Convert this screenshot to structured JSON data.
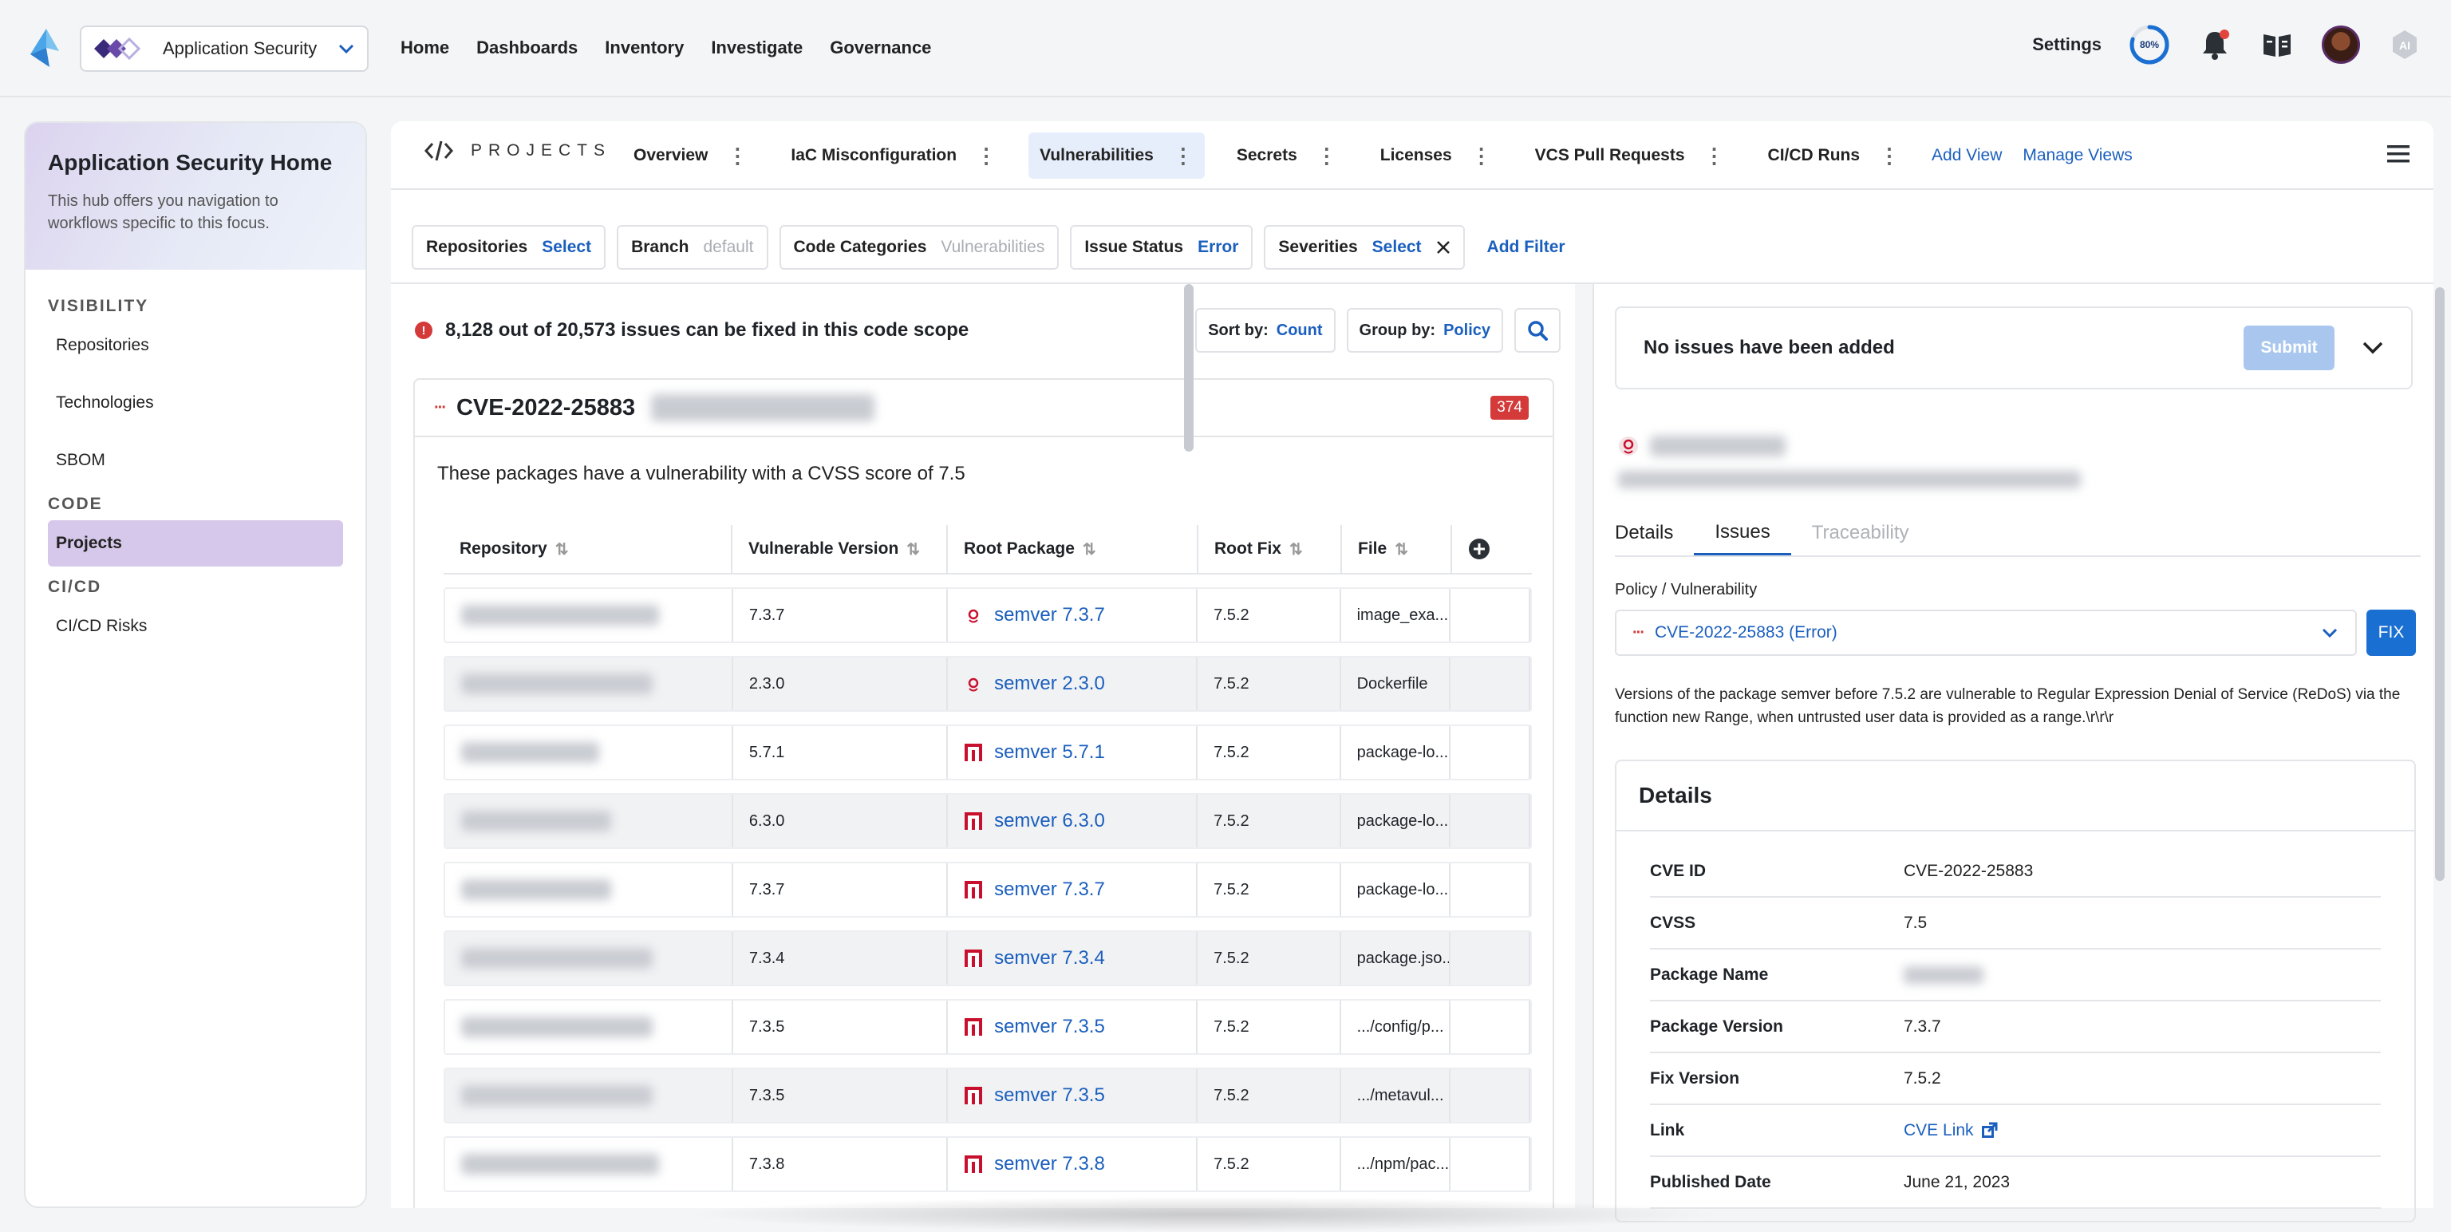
{
  "topnav": {
    "workspace": "Application Security",
    "items": [
      "Home",
      "Dashboards",
      "Inventory",
      "Investigate",
      "Governance"
    ],
    "active_item": "Home",
    "settings_label": "Settings",
    "progress_text": "80%",
    "progress_value": 0.8
  },
  "sidebar": {
    "title": "Application Security Home",
    "description": "This hub offers you navigation to workflows specific to this focus.",
    "sections": [
      {
        "label": "VISIBILITY",
        "items": [
          "Repositories",
          "Technologies",
          "SBOM"
        ]
      },
      {
        "label": "CODE",
        "items": [
          "Projects"
        ]
      },
      {
        "label": "CI/CD",
        "items": [
          "CI/CD Risks"
        ]
      }
    ],
    "active_item": "Projects"
  },
  "header": {
    "projects_label": "PROJECTS",
    "tabs": [
      "Overview",
      "IaC Misconfiguration",
      "Vulnerabilities",
      "Secrets",
      "Licenses",
      "VCS Pull Requests",
      "CI/CD Runs"
    ],
    "active_tab": "Vulnerabilities",
    "add_view": "Add View",
    "manage_views": "Manage Views"
  },
  "filters": [
    {
      "label": "Repositories",
      "value": "Select",
      "muted": false
    },
    {
      "label": "Branch",
      "value": "default",
      "muted": true
    },
    {
      "label": "Code Categories",
      "value": "Vulnerabilities",
      "muted": true
    },
    {
      "label": "Issue Status",
      "value": "Error",
      "muted": false
    },
    {
      "label": "Severities",
      "value": "Select",
      "muted": false
    }
  ],
  "add_filter": "Add Filter",
  "summary": "8,128 out of 20,573 issues can be fixed in this code scope",
  "sort": {
    "label": "Sort by:",
    "value": "Count"
  },
  "group": {
    "label": "Group by:",
    "value": "Policy"
  },
  "cve": {
    "id": "CVE-2022-25883",
    "count": "374",
    "description": "These packages have a vulnerability with a CVSS score of 7.5"
  },
  "table": {
    "columns": [
      "Repository",
      "Vulnerable Version",
      "Root Package",
      "Root Fix",
      "File"
    ],
    "rows": [
      {
        "version": "7.3.7",
        "package": "semver 7.3.7",
        "pkg_icon": "debian-icon",
        "fix": "7.5.2",
        "file": "image_exa..."
      },
      {
        "version": "2.3.0",
        "package": "semver 2.3.0",
        "pkg_icon": "debian-icon",
        "fix": "7.5.2",
        "file": "Dockerfile"
      },
      {
        "version": "5.7.1",
        "package": "semver 5.7.1",
        "pkg_icon": "npm-icon",
        "fix": "7.5.2",
        "file": "package-lo..."
      },
      {
        "version": "6.3.0",
        "package": "semver 6.3.0",
        "pkg_icon": "npm-icon",
        "fix": "7.5.2",
        "file": "package-lo..."
      },
      {
        "version": "7.3.7",
        "package": "semver 7.3.7",
        "pkg_icon": "npm-icon",
        "fix": "7.5.2",
        "file": "package-lo..."
      },
      {
        "version": "7.3.4",
        "package": "semver 7.3.4",
        "pkg_icon": "npm-icon",
        "fix": "7.5.2",
        "file": "package.jso..."
      },
      {
        "version": "7.3.5",
        "package": "semver 7.3.5",
        "pkg_icon": "npm-icon",
        "fix": "7.5.2",
        "file": ".../config/p..."
      },
      {
        "version": "7.3.5",
        "package": "semver 7.3.5",
        "pkg_icon": "npm-icon",
        "fix": "7.5.2",
        "file": ".../metavul..."
      },
      {
        "version": "7.3.8",
        "package": "semver 7.3.8",
        "pkg_icon": "npm-icon",
        "fix": "7.5.2",
        "file": ".../npm/pac..."
      }
    ]
  },
  "right": {
    "issues_title": "No issues have been added",
    "submit": "Submit",
    "tabs": [
      "Details",
      "Issues",
      "Traceability"
    ],
    "active_tab": "Issues",
    "policy_label": "Policy / Vulnerability",
    "policy_value": "CVE-2022-25883 (Error)",
    "fix": "FIX",
    "vuln_description": "Versions of the package semver before 7.5.2 are vulnerable to Regular Expression Denial of Service (ReDoS) via the function new Range, when untrusted user data is provided as a range.\\r\\r\\r",
    "details_title": "Details",
    "details": [
      {
        "key": "CVE ID",
        "value": "CVE-2022-25883"
      },
      {
        "key": "CVSS",
        "value": "7.5"
      },
      {
        "key": "Package Name",
        "value": ""
      },
      {
        "key": "Package Version",
        "value": "7.3.7"
      },
      {
        "key": "Fix Version",
        "value": "7.5.2"
      },
      {
        "key": "Link",
        "value": "CVE Link"
      },
      {
        "key": "Published Date",
        "value": "June 21, 2023"
      }
    ]
  },
  "colors": {
    "accent": "#1b5fbe",
    "active_nav": "#d6c8ea",
    "error": "#d43a3a",
    "fix_button": "#1a6fd2"
  }
}
